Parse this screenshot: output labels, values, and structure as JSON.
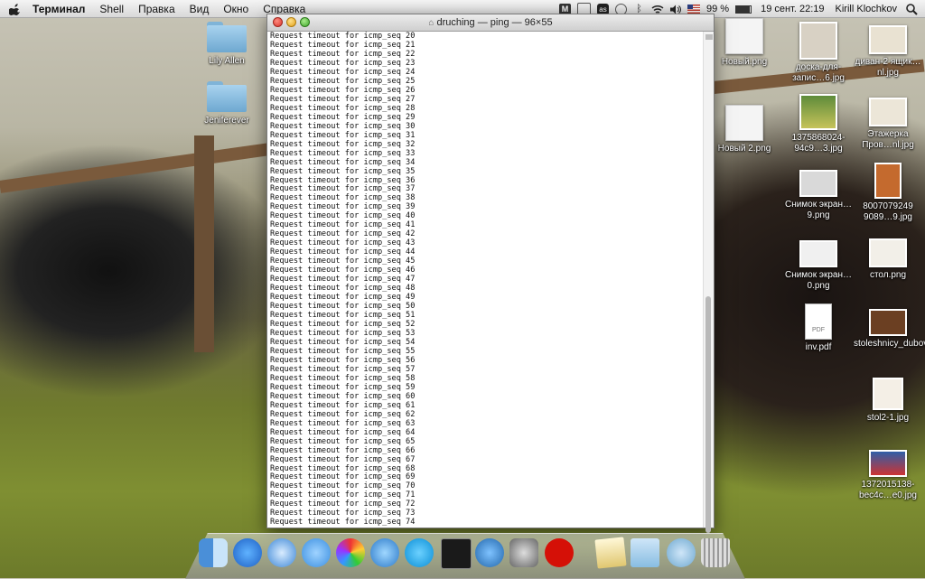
{
  "menubar": {
    "app": "Терминал",
    "items": [
      "Shell",
      "Правка",
      "Вид",
      "Окно",
      "Справка"
    ],
    "battery": "99 %",
    "datetime": "19 сент.  22:19",
    "user": "Kirill Klochkov"
  },
  "terminal": {
    "title": "druching — ping — 96×55",
    "lines": [
      "Request timeout for icmp_seq 20",
      "Request timeout for icmp_seq 21",
      "Request timeout for icmp_seq 22",
      "Request timeout for icmp_seq 23",
      "Request timeout for icmp_seq 24",
      "Request timeout for icmp_seq 25",
      "Request timeout for icmp_seq 26",
      "Request timeout for icmp_seq 27",
      "Request timeout for icmp_seq 28",
      "Request timeout for icmp_seq 29",
      "Request timeout for icmp_seq 30",
      "Request timeout for icmp_seq 31",
      "Request timeout for icmp_seq 32",
      "Request timeout for icmp_seq 33",
      "Request timeout for icmp_seq 34",
      "Request timeout for icmp_seq 35",
      "Request timeout for icmp_seq 36",
      "Request timeout for icmp_seq 37",
      "Request timeout for icmp_seq 38",
      "Request timeout for icmp_seq 39",
      "Request timeout for icmp_seq 40",
      "Request timeout for icmp_seq 41",
      "Request timeout for icmp_seq 42",
      "Request timeout for icmp_seq 43",
      "Request timeout for icmp_seq 44",
      "Request timeout for icmp_seq 45",
      "Request timeout for icmp_seq 46",
      "Request timeout for icmp_seq 47",
      "Request timeout for icmp_seq 48",
      "Request timeout for icmp_seq 49",
      "Request timeout for icmp_seq 50",
      "Request timeout for icmp_seq 51",
      "Request timeout for icmp_seq 52",
      "Request timeout for icmp_seq 53",
      "Request timeout for icmp_seq 54",
      "Request timeout for icmp_seq 55",
      "Request timeout for icmp_seq 56",
      "Request timeout for icmp_seq 57",
      "Request timeout for icmp_seq 58",
      "Request timeout for icmp_seq 59",
      "Request timeout for icmp_seq 60",
      "Request timeout for icmp_seq 61",
      "Request timeout for icmp_seq 62",
      "Request timeout for icmp_seq 63",
      "Request timeout for icmp_seq 64",
      "Request timeout for icmp_seq 65",
      "Request timeout for icmp_seq 66",
      "Request timeout for icmp_seq 67",
      "Request timeout for icmp_seq 68",
      "Request timeout for icmp_seq 69",
      "Request timeout for icmp_seq 70",
      "Request timeout for icmp_seq 71",
      "Request timeout for icmp_seq 72",
      "Request timeout for icmp_seq 73",
      "Request timeout for icmp_seq 74"
    ]
  },
  "desktop": {
    "folders": [
      "Lily Allen",
      "Jeniferever"
    ],
    "files": [
      "Новый.png",
      "доска-для-запис…6.jpg",
      "диван-2 ящик…nl.jpg",
      "Новый 2.png",
      "1375868024-94c9…3.jpg",
      "Этажерка Пров…nl.jpg",
      "Снимок экран…9.png",
      "8007079249 9089…9.jpg",
      "Снимок экран…0.png",
      "стол.png",
      "inv.pdf",
      "stoleshnicy_dubovye.jpg",
      "stol2-1.jpg",
      "1372015138-bec4c…e0.jpg"
    ]
  },
  "colors": {
    "menubar": "#e6e6e6",
    "terminal_bg": "#ffffff",
    "close": "#d8332a",
    "minimize": "#e2a21a",
    "zoom": "#3ea52a"
  },
  "dock": {
    "apps": [
      "finder-icon",
      "app-store-icon",
      "safari-icon",
      "messages-icon",
      "flowplayer-icon",
      "itunes-icon",
      "skype-icon",
      "terminal-icon",
      "tweet-icon",
      "system-preferences-icon",
      "lastfm-icon",
      "textedit-icon",
      "folder-icon",
      "downloads-icon",
      "trash-icon"
    ]
  }
}
